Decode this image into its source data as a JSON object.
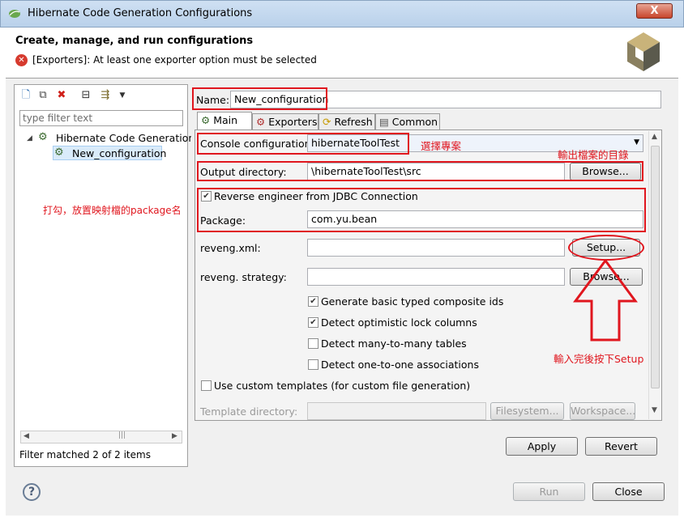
{
  "window": {
    "title": "Hibernate Code Generation Configurations",
    "close_label": "X"
  },
  "header": {
    "title": "Create, manage, and run configurations",
    "error_text": "[Exporters]: At least one exporter option must be selected"
  },
  "left": {
    "filter_placeholder": "type filter text",
    "tree": [
      {
        "label": "Hibernate Code Generation",
        "expanded": true
      },
      {
        "label": "New_configuration",
        "selected": true
      }
    ],
    "status": "Filter matched 2 of 2 items",
    "annotation": "打勾，放置映射檔的package名"
  },
  "name": {
    "label": "Name:",
    "value": "New_configuration"
  },
  "tabs": [
    {
      "label": "Main",
      "active": true,
      "icon": "main-tab-icon"
    },
    {
      "label": "Exporters",
      "icon": "exporters-icon"
    },
    {
      "label": "Refresh",
      "icon": "refresh-icon"
    },
    {
      "label": "Common",
      "icon": "common-icon"
    }
  ],
  "main": {
    "console_label": "Console configuration:",
    "console_value": "hibernateToolTest",
    "console_annotation": "選擇專案",
    "output_annotation": "輸出檔案的目錄",
    "output_label": "Output directory:",
    "output_value": "\\hibernateToolTest\\src",
    "browse_label": "Browse...",
    "reverse_label": "Reverse engineer from JDBC Connection",
    "reverse_checked": true,
    "package_label": "Package:",
    "package_value": "com.yu.bean",
    "reveng_xml_label": "reveng.xml:",
    "reveng_xml_value": "",
    "setup_label": "Setup...",
    "reveng_strategy_label": "reveng. strategy:",
    "reveng_strategy_value": "",
    "browse2_label": "Browse...",
    "options": [
      {
        "label": "Generate basic typed composite ids",
        "checked": true
      },
      {
        "label": "Detect optimistic lock columns",
        "checked": true
      },
      {
        "label": "Detect many-to-many tables",
        "checked": false
      },
      {
        "label": "Detect one-to-one associations",
        "checked": false
      }
    ],
    "setup_annotation": "輸入完後按下Setup",
    "custom_templates_label": "Use custom templates (for custom file generation)",
    "custom_templates_checked": false,
    "template_dir_label": "Template directory:",
    "filesystem_label": "Filesystem...",
    "workspace_label": "Workspace..."
  },
  "buttons": {
    "apply": "Apply",
    "revert": "Revert",
    "run": "Run",
    "close": "Close",
    "help": "?"
  },
  "colors": {
    "annotation": "#e0161e",
    "error": "#d63a2e"
  }
}
